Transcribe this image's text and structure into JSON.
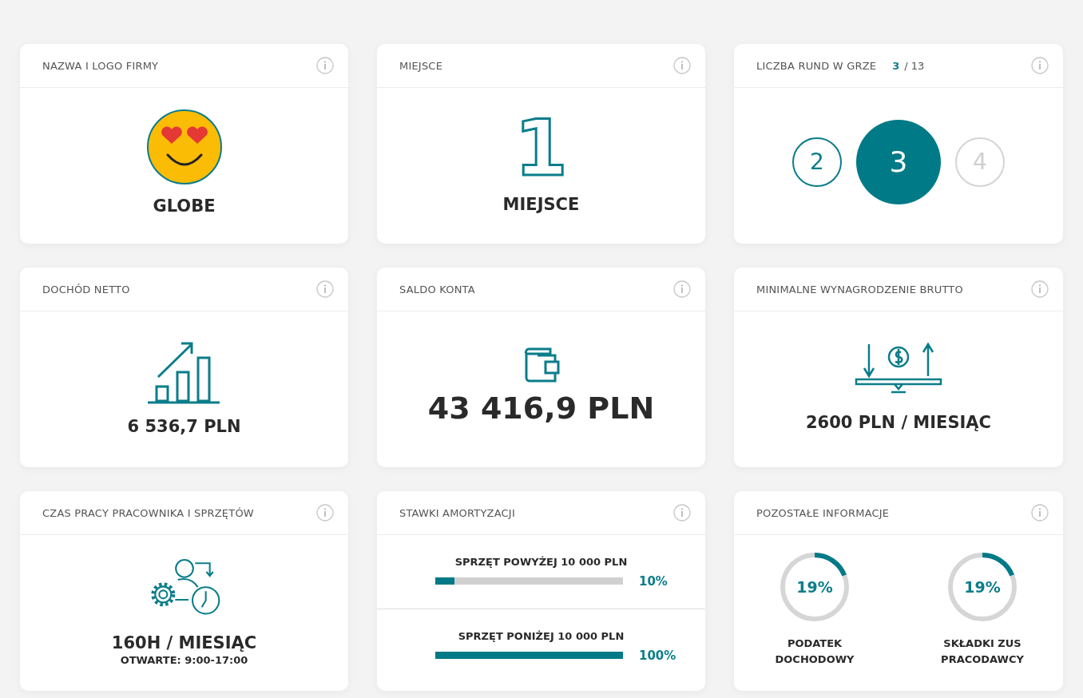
{
  "cards": [
    {
      "kind": "logo",
      "title": "NAZWA I LOGO FIRMY",
      "value": "GLOBE"
    },
    {
      "kind": "place",
      "title": "MIEJSCE",
      "digit": "1",
      "value": "MIEJSCE"
    },
    {
      "kind": "rounds",
      "title": "LICZBA RUND W GRZE",
      "current": "3",
      "total": "/ 13",
      "rounds": [
        {
          "label": "2",
          "selected": false,
          "done": true
        },
        {
          "label": "3",
          "selected": true
        },
        {
          "label": "4",
          "selected": false,
          "done": false
        }
      ]
    },
    {
      "kind": "chart-value",
      "title": "DOCHÓD NETTO",
      "value": "6 536,7 PLN"
    },
    {
      "kind": "wallet-value",
      "title": "SALDO KONTA",
      "value": "43 416,9 PLN"
    },
    {
      "kind": "scale-value",
      "title": "MINIMALNE WYNAGRODZENIE BRUTTO",
      "value": "2600 PLN / MIESIĄC"
    },
    {
      "kind": "time-value",
      "title": "CZAS PRACY PRACOWNIKA I SPRZĘTÓW",
      "value": "160H / MIESIĄC",
      "note": "OTWARTE: 9:00-17:00"
    },
    {
      "kind": "bars",
      "title": "STAWKI AMORTYZACJI",
      "rows": [
        {
          "label": "SPRZĘT POWYŻEJ 10 000 PLN",
          "level": 0.1,
          "reading": "10%"
        },
        {
          "label": "SPRZĘT PONIŻEJ 10 000 PLN",
          "level": 1,
          "reading": "100%"
        }
      ]
    },
    {
      "kind": "rings",
      "title": "POZOSTAŁE INFORMACJE",
      "rings": [
        {
          "reading": "19%",
          "level": 0.19,
          "label": "PODATEK DOCHODOWY"
        },
        {
          "reading": "19%",
          "level": 0.19,
          "label": "SKŁADKI ZUS PRACODAWCY"
        }
      ]
    }
  ]
}
